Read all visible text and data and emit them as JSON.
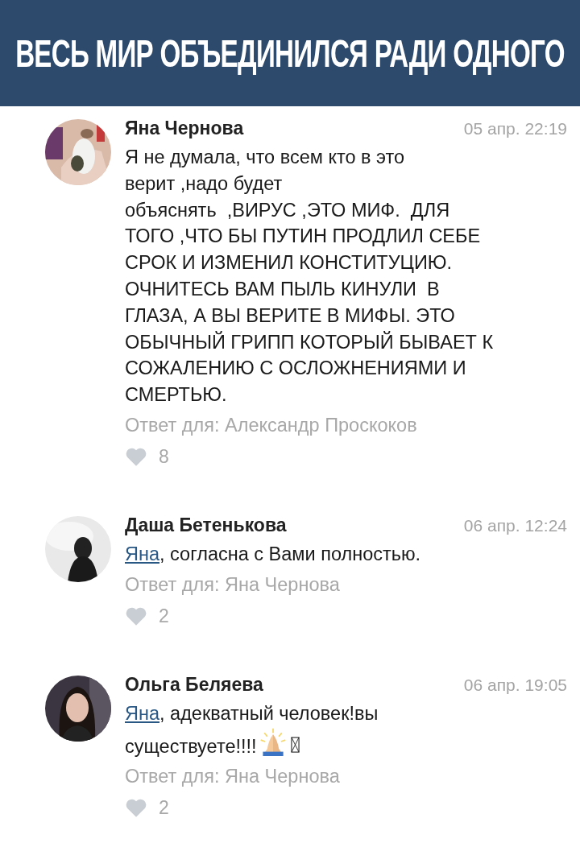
{
  "header": {
    "title": "ВЕСЬ МИР ОБЪЕДИНИЛСЯ РАДИ ОДНОГО"
  },
  "comments": [
    {
      "author": "Яна Чернова",
      "date": "05 апр. 22:19",
      "text": "Я не думала, что всем кто в это\nверит ,надо будет\nобъяснять  ,ВИРУС ,ЭТО МИФ.  ДЛЯ\nТОГО ,ЧТО БЫ ПУТИН ПРОДЛИЛ СЕБЕ\nСРОК И ИЗМЕНИЛ КОНСТИТУЦИЮ.\nОЧНИТЕСЬ ВАМ ПЫЛЬ КИНУЛИ  В\nГЛАЗА, А ВЫ ВЕРИТЕ В МИФЫ. ЭТО\nОБЫЧНЫЙ ГРИПП КОТОРЫЙ БЫВАЕТ К\nСОЖАЛЕНИЮ С ОСЛОЖНЕНИЯМИ И\nСМЕРТЬЮ.",
      "reply_to": "Ответ для: Александр Проскоков",
      "likes": "8"
    },
    {
      "author": "Даша Бетенькова",
      "date": "06 апр. 12:24",
      "mention": "Яна",
      "text": ", согласна с Вами полностью.",
      "reply_to": "Ответ для: Яна Чернова",
      "likes": "2"
    },
    {
      "author": "Ольга Беляева",
      "date": "06 апр. 19:05",
      "mention": "Яна",
      "text": ", адекватный человек!вы\nсуществуете!!!!",
      "emoji": true,
      "reply_to": "Ответ для: Яна Чернова",
      "likes": "2"
    }
  ]
}
